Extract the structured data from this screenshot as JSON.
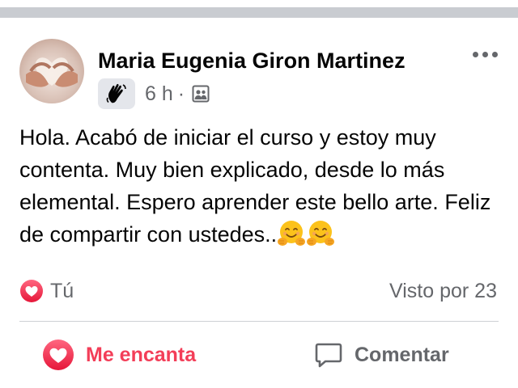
{
  "post": {
    "author": "Maria Eugenia Giron Martinez",
    "time": "6 h",
    "separator": "·",
    "badge_icon": "waving-hand-icon",
    "privacy_icon": "group-members-icon",
    "text": "Hola. Acabó de iniciar el curso y estoy muy contenta. Muy bien explicado, desde lo más elemental. Espero aprender este bello arte. Feliz de compartir con ustedes..",
    "emojis": [
      "hugging-face-icon",
      "hugging-face-icon"
    ]
  },
  "reactions": {
    "icon": "love-reaction-icon",
    "label": "Tú",
    "seen_by": "Visto por 23"
  },
  "actions": {
    "love_label": "Me encanta",
    "comment_label": "Comentar"
  },
  "colors": {
    "love": "#f33e58",
    "secondary_text": "#65676b",
    "divider": "#ced0d4"
  }
}
